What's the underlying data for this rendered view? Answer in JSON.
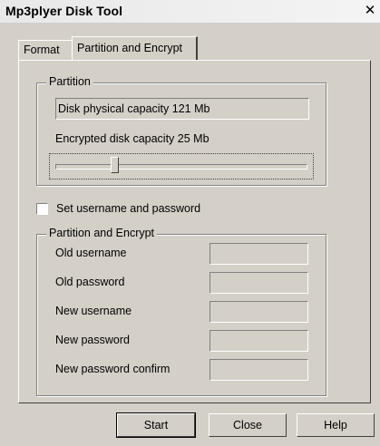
{
  "window": {
    "title": "Mp3plyer Disk Tool",
    "close_glyph": "✕"
  },
  "tabs": [
    {
      "label": "Format",
      "active": false
    },
    {
      "label": "Partition and Encrypt",
      "active": true
    }
  ],
  "partition_group": {
    "legend": "Partition",
    "physical_capacity": "Disk physical capacity 121 Mb",
    "encrypted_capacity": "Encrypted disk capacity 25 Mb",
    "slider_fraction": 0.23
  },
  "set_credentials": {
    "label": "Set username and password",
    "checked": false
  },
  "encrypt_group": {
    "legend": "Partition and Encrypt",
    "fields": [
      {
        "label": "Old username",
        "value": ""
      },
      {
        "label": "Old password",
        "value": ""
      },
      {
        "label": "New username",
        "value": ""
      },
      {
        "label": "New password",
        "value": ""
      },
      {
        "label": "New password confirm",
        "value": ""
      }
    ]
  },
  "buttons": {
    "start": "Start",
    "close": "Close",
    "help": "Help"
  },
  "colors": {
    "face": "#d4d0c8",
    "shadow": "#808080",
    "highlight": "#ffffff"
  }
}
